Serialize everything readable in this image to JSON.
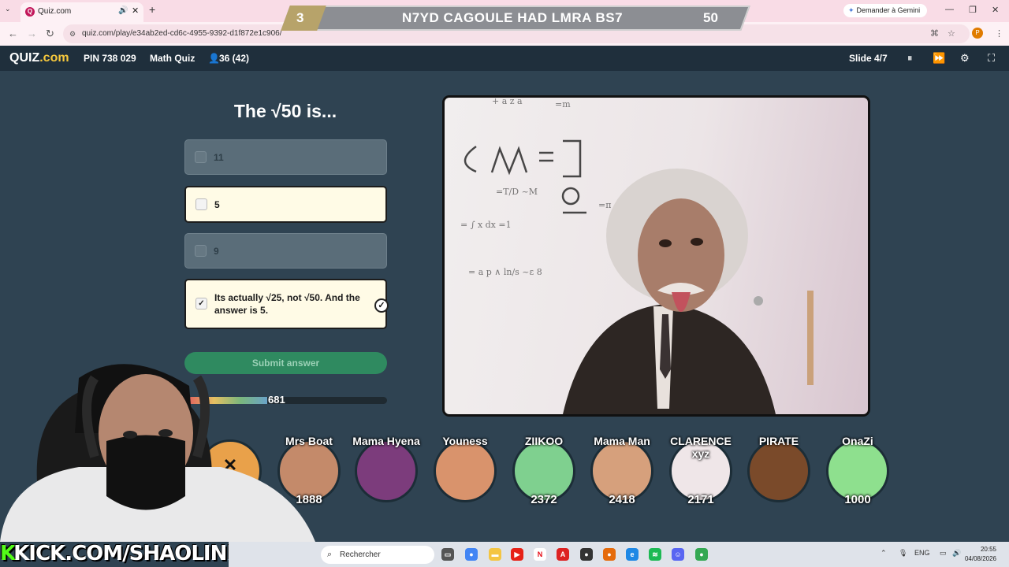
{
  "browser": {
    "tab_title": "Quiz.com",
    "new_tab": "+",
    "url": "quiz.com/play/e34ab2ed-cd6c-4955-9392-d1f872e1c906/",
    "gemini_label": "Demander à Gemini",
    "profile_initial": "P"
  },
  "banner": {
    "left_number": "3",
    "title": "N7YD CAGOULE HAD LMRA BS7",
    "right_number": "50"
  },
  "quiz_header": {
    "logo_a": "QUIZ",
    "logo_b": ".com",
    "pin": "PIN 738 029",
    "quiz_name": "Math Quiz",
    "players": "36 (42)",
    "slide": "Slide 4/7"
  },
  "question": {
    "text": "The √50 is...",
    "answers": [
      {
        "label": "11",
        "checked": false
      },
      {
        "label": "5",
        "checked": false
      },
      {
        "label": "9",
        "checked": false
      },
      {
        "label": "Its actually √25, not √50. And the answer is 5.",
        "checked": true
      }
    ],
    "submit_label": "Submit answer",
    "score": "681",
    "timer_fraction": 0.4
  },
  "players": [
    {
      "name": "Mrs Boat",
      "points": "1888"
    },
    {
      "name": "Mama Hyena",
      "points": ""
    },
    {
      "name": "Youness",
      "points": ""
    },
    {
      "name": "ZIIKOO",
      "points": "2372"
    },
    {
      "name": "Mama Man",
      "points": "2418"
    },
    {
      "name": "CLARENCE xyz",
      "points": "2171"
    },
    {
      "name": "PIRATE",
      "points": ""
    },
    {
      "name": "OnaZi",
      "points": "1000"
    }
  ],
  "overlay": {
    "kick_k": "K",
    "kick_rest": "KICK.COM/SHAOLINE"
  },
  "taskbar": {
    "search_placeholder": "Rechercher",
    "lang": "ENG",
    "time": "20:55",
    "date": "04/08/2026"
  },
  "colors": {
    "accent_green": "#2f8a60",
    "background": "#2f4352",
    "kick_green": "#53fc18"
  }
}
